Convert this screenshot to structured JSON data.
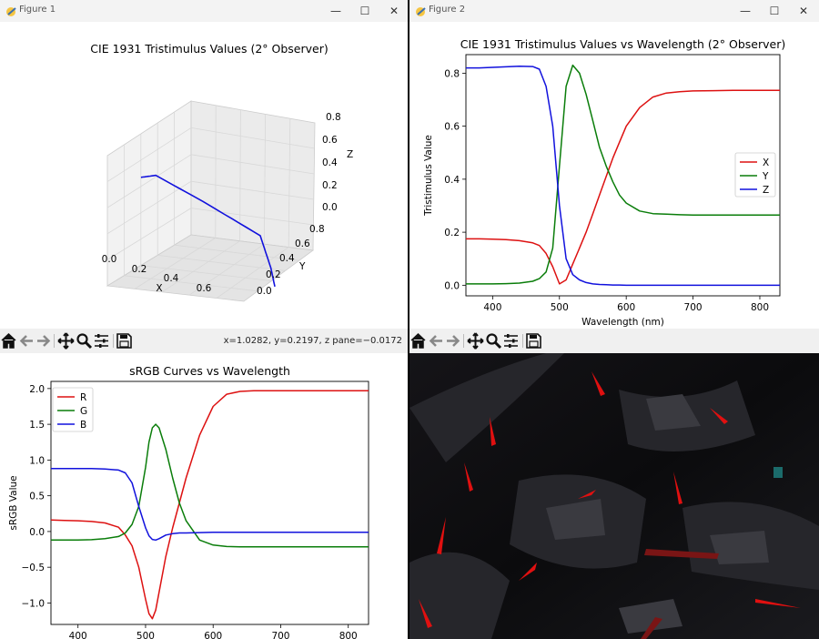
{
  "windows": {
    "fig1": {
      "title": "Figure 1",
      "plot_title": "CIE 1931 Tristimulus Values (2° Observer)",
      "x_ticks": [
        "0.0",
        "0.2",
        "0.4",
        "0.6"
      ],
      "y_ticks": [
        "0.0",
        "0.2",
        "0.4",
        "0.6",
        "0.8"
      ],
      "z_ticks": [
        "0.0",
        "0.2",
        "0.4",
        "0.6",
        "0.8"
      ],
      "xlabel": "X",
      "ylabel": "Y",
      "zlabel": "Z",
      "coord_readout": "x=1.0282, y=0.2197, z pane=−0.0172"
    },
    "fig2": {
      "title": "Figure 2",
      "plot_title": "CIE 1931 Tristimulus Values vs Wavelength (2° Observer)",
      "xlabel": "Wavelength (nm)",
      "ylabel": "Tristimulus Value",
      "x_ticks": [
        "400",
        "500",
        "600",
        "700",
        "800"
      ],
      "y_ticks": [
        "0.0",
        "0.2",
        "0.4",
        "0.6",
        "0.8"
      ],
      "legend": [
        "X",
        "Y",
        "Z"
      ]
    },
    "fig3": {
      "plot_title": "sRGB Curves vs Wavelength",
      "ylabel": "sRGB Value",
      "x_ticks": [
        "400",
        "500",
        "600",
        "700",
        "800"
      ],
      "y_ticks": [
        "2.0",
        "1.5",
        "1.0",
        "0.5",
        "0.0",
        "−0.5",
        "−1.0"
      ],
      "legend": [
        "R",
        "G",
        "B"
      ]
    }
  },
  "window_controls": {
    "minimize": "—",
    "maximize": "☐",
    "close": "✕"
  },
  "toolbar_icons": [
    "home-icon",
    "back-icon",
    "forward-icon",
    "pan-icon",
    "zoom-icon",
    "configure-icon",
    "save-icon"
  ],
  "colors": {
    "red": "#dd1111",
    "green": "#0a7d0a",
    "blue": "#1111dd",
    "background_art": "#0d0d10",
    "accent_red": "#e01010"
  },
  "chart_data": [
    {
      "type": "line",
      "title": "CIE 1931 Tristimulus Values (2° Observer)",
      "subtype": "3d",
      "xlabel": "X",
      "ylabel": "Y",
      "zlabel": "Z",
      "xlim": [
        0,
        0.7
      ],
      "ylim": [
        0,
        0.9
      ],
      "zlim": [
        0,
        0.9
      ],
      "series": [
        {
          "x": [
            0.17,
            0.2,
            0.3,
            0.45,
            0.6,
            0.73
          ],
          "y": [
            0.005,
            0.1,
            0.4,
            0.7,
            0.5,
            0.27
          ],
          "z": [
            0.82,
            0.8,
            0.5,
            0.15,
            0.02,
            0.0
          ]
        }
      ]
    },
    {
      "type": "line",
      "title": "CIE 1931 Tristimulus Values vs Wavelength (2° Observer)",
      "xlabel": "Wavelength (nm)",
      "ylabel": "Tristimulus Value",
      "xlim": [
        360,
        830
      ],
      "ylim": [
        -0.04,
        0.87
      ],
      "legend_position": "center-right",
      "x": [
        360,
        380,
        400,
        420,
        440,
        460,
        470,
        480,
        490,
        500,
        510,
        520,
        530,
        540,
        550,
        560,
        570,
        580,
        590,
        600,
        620,
        640,
        660,
        680,
        700,
        730,
        760,
        800,
        830
      ],
      "series": [
        {
          "name": "X",
          "values": [
            0.175,
            0.175,
            0.174,
            0.172,
            0.168,
            0.16,
            0.15,
            0.12,
            0.07,
            0.005,
            0.02,
            0.08,
            0.14,
            0.2,
            0.27,
            0.34,
            0.41,
            0.48,
            0.54,
            0.6,
            0.67,
            0.71,
            0.725,
            0.73,
            0.733,
            0.734,
            0.735,
            0.735,
            0.735
          ]
        },
        {
          "name": "Y",
          "values": [
            0.005,
            0.005,
            0.005,
            0.006,
            0.008,
            0.015,
            0.025,
            0.05,
            0.14,
            0.45,
            0.75,
            0.83,
            0.8,
            0.72,
            0.62,
            0.52,
            0.45,
            0.39,
            0.34,
            0.31,
            0.28,
            0.27,
            0.268,
            0.266,
            0.265,
            0.265,
            0.265,
            0.265,
            0.265
          ]
        },
        {
          "name": "Z",
          "values": [
            0.82,
            0.82,
            0.822,
            0.824,
            0.826,
            0.825,
            0.815,
            0.75,
            0.6,
            0.3,
            0.1,
            0.04,
            0.02,
            0.01,
            0.005,
            0.003,
            0.002,
            0.001,
            0.001,
            0.0,
            0.0,
            0.0,
            0.0,
            0.0,
            0.0,
            0.0,
            0.0,
            0.0,
            0.0
          ]
        }
      ]
    },
    {
      "type": "line",
      "title": "sRGB Curves vs Wavelength",
      "xlabel": "",
      "ylabel": "sRGB Value",
      "xlim": [
        360,
        830
      ],
      "ylim": [
        -1.3,
        2.1
      ],
      "legend_position": "top-left",
      "x": [
        360,
        380,
        400,
        420,
        440,
        460,
        470,
        480,
        490,
        500,
        505,
        510,
        515,
        520,
        530,
        540,
        550,
        560,
        580,
        600,
        620,
        640,
        660,
        680,
        700,
        730,
        760,
        800,
        830
      ],
      "series": [
        {
          "name": "R",
          "values": [
            0.16,
            0.155,
            0.15,
            0.14,
            0.12,
            0.06,
            -0.05,
            -0.2,
            -0.5,
            -0.95,
            -1.15,
            -1.22,
            -1.1,
            -0.85,
            -0.35,
            0.05,
            0.4,
            0.75,
            1.35,
            1.75,
            1.92,
            1.96,
            1.97,
            1.97,
            1.97,
            1.97,
            1.97,
            1.97,
            1.97
          ]
        },
        {
          "name": "G",
          "values": [
            -0.12,
            -0.12,
            -0.12,
            -0.115,
            -0.1,
            -0.07,
            -0.02,
            0.1,
            0.35,
            0.9,
            1.25,
            1.45,
            1.5,
            1.45,
            1.15,
            0.75,
            0.4,
            0.15,
            -0.12,
            -0.19,
            -0.21,
            -0.215,
            -0.215,
            -0.215,
            -0.215,
            -0.215,
            -0.215,
            -0.215,
            -0.215
          ]
        },
        {
          "name": "B",
          "values": [
            0.88,
            0.88,
            0.88,
            0.88,
            0.875,
            0.86,
            0.82,
            0.68,
            0.35,
            0.05,
            -0.06,
            -0.11,
            -0.12,
            -0.1,
            -0.05,
            -0.03,
            -0.02,
            -0.02,
            -0.015,
            -0.01,
            -0.01,
            -0.01,
            -0.01,
            -0.01,
            -0.01,
            -0.01,
            -0.01,
            -0.01,
            -0.01
          ]
        }
      ]
    }
  ]
}
